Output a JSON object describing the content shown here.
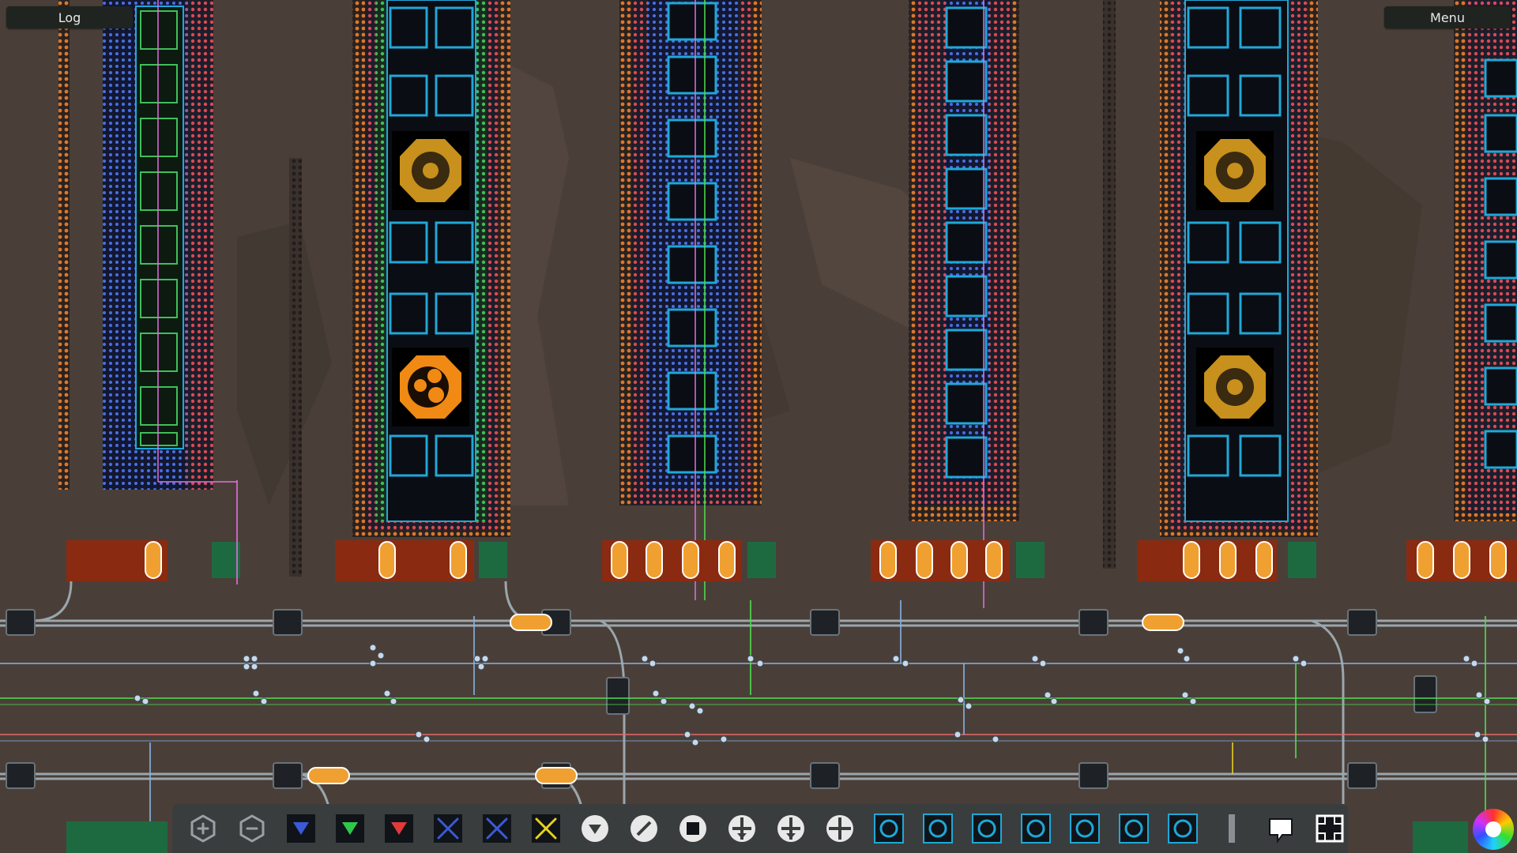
{
  "hud": {
    "log_label": "Log",
    "menu_label": "Menu"
  },
  "palette": {
    "ground": "#4a3f38",
    "ground_dark": "#3d342e",
    "board": "#1c1e2a",
    "pad_orange": "#d9782e",
    "pad_red": "#d94a55",
    "pad_green": "#3fbf5a",
    "pad_blue": "#4a6fe0",
    "cell_border": "#1fa8d8",
    "cell_fill": "#0a0d14",
    "wire_blue": "#86b4e6",
    "wire_green": "#4ee04e",
    "wire_red": "#e86a6a",
    "wire_pink": "#e070e0",
    "belt": "#9aa6ad",
    "node_orange": "#f0a030",
    "emblem_gold": "#c8901c",
    "emblem_orange": "#f08a14"
  },
  "emblems": [
    {
      "type": "eye"
    },
    {
      "type": "cells"
    },
    {
      "type": "eye"
    },
    {
      "type": "eye"
    }
  ],
  "toolbar": [
    {
      "name": "hex-plus-tool-icon",
      "color": "#9aa0a6"
    },
    {
      "name": "hex-minus-tool-icon",
      "color": "#9aa0a6"
    },
    {
      "name": "triangle-blue-tool-icon",
      "color": "#3a5ad8"
    },
    {
      "name": "triangle-green-tool-icon",
      "color": "#2fc84a"
    },
    {
      "name": "triangle-red-tool-icon",
      "color": "#e03a3a"
    },
    {
      "name": "cross-blue-tool-icon",
      "color": "#3a5ad8"
    },
    {
      "name": "cross-blue-alt-tool-icon",
      "color": "#3a5ad8"
    },
    {
      "name": "cross-yellow-tool-icon",
      "color": "#e8d020"
    },
    {
      "name": "chevron-circle-tool-icon",
      "color": "#e8e8e8"
    },
    {
      "name": "pencil-tool-icon",
      "color": "#e8e8e8"
    },
    {
      "name": "stop-tool-icon",
      "color": "#e8e8e8"
    },
    {
      "name": "merge-down-tool-icon",
      "color": "#e8e8e8"
    },
    {
      "name": "split-down-tool-icon",
      "color": "#e8e8e8"
    },
    {
      "name": "move-tool-icon",
      "color": "#e8e8e8"
    },
    {
      "name": "shower-tool-icon",
      "color": "#1fa8d8"
    },
    {
      "name": "pipette-tool-icon",
      "color": "#1fa8d8"
    },
    {
      "name": "hand-tool-icon",
      "color": "#1fa8d8"
    },
    {
      "name": "layers-tool-icon",
      "color": "#1fa8d8"
    },
    {
      "name": "spiral-tool-icon",
      "color": "#1fa8d8"
    },
    {
      "name": "gear-tool-icon",
      "color": "#1fa8d8"
    },
    {
      "name": "lock-tool-icon",
      "color": "#1fa8d8"
    },
    {
      "name": "divider-icon",
      "color": "#8a8f94"
    },
    {
      "name": "speech-bubble-tool-icon",
      "color": "#ffffff"
    },
    {
      "name": "frame-tool-icon",
      "color": "#ffffff"
    }
  ]
}
